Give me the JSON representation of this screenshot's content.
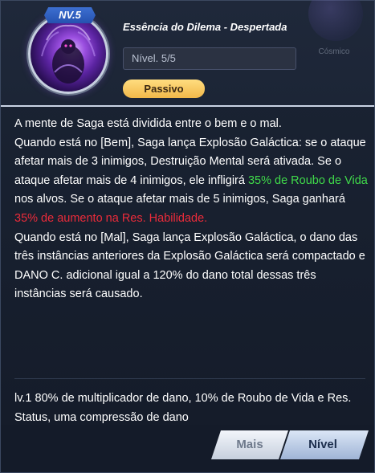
{
  "skill": {
    "level_badge": "NV.5",
    "name": "Essência do Dilema - Despertada",
    "level_field": "Nível. 5/5",
    "type_label": "Passivo"
  },
  "background": {
    "ghost_label": "Cósmico"
  },
  "description": {
    "p1": "A mente de Saga está dividida entre o bem e o mal.",
    "p2_a": "Quando está no [Bem], Saga lança Explosão Galáctica: se o ataque afetar mais de 3 inimigos, Destruição Mental será ativada. Se o ataque afetar mais de 4 inimigos, ele infligirá ",
    "p2_green": "35% de Roubo de Vida",
    "p2_b": " nos alvos. Se o ataque afetar mais de 5 inimigos, Saga ganhará ",
    "p2_red": "35% de aumento na Res. Habilidade.",
    "p3": "Quando está no [Mal], Saga lança Explosão Galáctica, o dano das três instâncias anteriores da Explosão Galáctica será compactado e DANO C. adicional igual a 120% do dano total dessas três instâncias será causado."
  },
  "levels_text": "lv.1 80% de multiplicador de dano, 10% de Roubo de Vida e Res. Status, uma compressão de dano",
  "buttons": {
    "more": "Mais",
    "level": "Nível"
  },
  "colors": {
    "accent_green": "#3fd94a",
    "accent_red": "#ec2b3a",
    "passive_gold": "#f2b84a",
    "badge_blue": "#2552b0"
  }
}
